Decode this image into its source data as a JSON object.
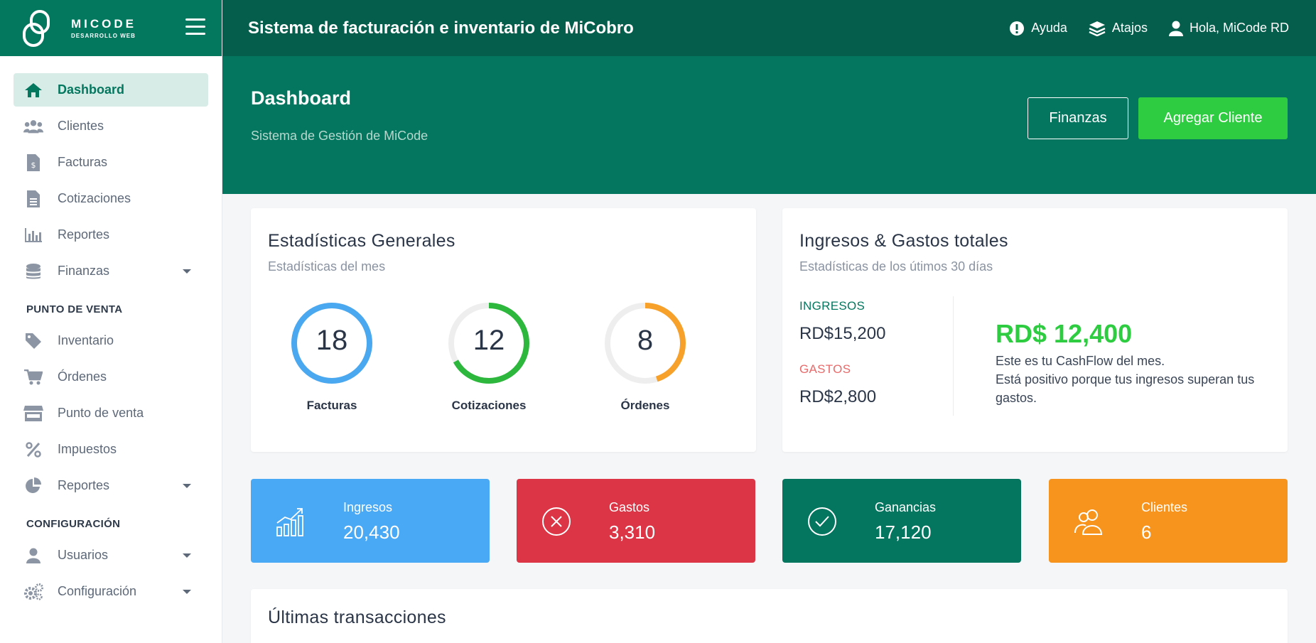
{
  "brand": {
    "name": "MICODE",
    "tagline": "DESARROLLO WEB"
  },
  "topbar": {
    "title": "Sistema de facturación e inventario de MiCobro",
    "help": "Ayuda",
    "shortcuts": "Atajos",
    "user": "Hola, MiCode RD"
  },
  "sidebar": {
    "items": [
      {
        "label": "Dashboard",
        "icon": "home-icon"
      },
      {
        "label": "Clientes",
        "icon": "users-icon"
      },
      {
        "label": "Facturas",
        "icon": "invoice-icon"
      },
      {
        "label": "Cotizaciones",
        "icon": "file-icon"
      },
      {
        "label": "Reportes",
        "icon": "bar-chart-icon"
      },
      {
        "label": "Finanzas",
        "icon": "coins-icon"
      }
    ],
    "section_pos": "PUNTO DE VENTA",
    "pos_items": [
      {
        "label": "Inventario",
        "icon": "tag-icon"
      },
      {
        "label": "Órdenes",
        "icon": "cart-icon"
      },
      {
        "label": "Punto de venta",
        "icon": "store-icon"
      },
      {
        "label": "Impuestos",
        "icon": "percent-icon"
      },
      {
        "label": "Reportes",
        "icon": "pie-chart-icon"
      }
    ],
    "section_config": "CONFIGURACIÓN",
    "config_items": [
      {
        "label": "Usuarios",
        "icon": "user-icon"
      },
      {
        "label": "Configuración",
        "icon": "gears-icon"
      }
    ]
  },
  "banner": {
    "title": "Dashboard",
    "subtitle": "Sistema de Gestión de MiCode",
    "btn_finance": "Finanzas",
    "btn_add_client": "Agregar Cliente"
  },
  "general_stats": {
    "title": "Estadísticas Generales",
    "subtitle": "Estadísticas del mes",
    "items": [
      {
        "value": "18",
        "label": "Facturas",
        "fraction": 1.0,
        "color": "#4aa8f0"
      },
      {
        "value": "12",
        "label": "Cotizaciones",
        "fraction": 0.67,
        "color": "#2db83d"
      },
      {
        "value": "8",
        "label": "Órdenes",
        "fraction": 0.45,
        "color": "#f7a12a"
      }
    ]
  },
  "income_expenses": {
    "title": "Ingresos & Gastos totales",
    "subtitle": "Estadísticas de los útimos 30 días",
    "income_label": "INGRESOS",
    "income_value": "RD$15,200",
    "expense_label": "GASTOS",
    "expense_value": "RD$2,800",
    "cashflow_value": "RD$ 12,400",
    "cashflow_text1": "Este es tu CashFlow del mes.",
    "cashflow_text2": "Está positivo porque tus ingresos superan tus gastos."
  },
  "tiles": [
    {
      "label": "Ingresos",
      "value": "20,430",
      "color": "#4aa9f5",
      "icon": "growth-chart-icon"
    },
    {
      "label": "Gastos",
      "value": "3,310",
      "color": "#dc3545",
      "icon": "x-circle-icon"
    },
    {
      "label": "Ganancias",
      "value": "17,120",
      "color": "#04755e",
      "icon": "check-circle-icon"
    },
    {
      "label": "Clientes",
      "value": "6",
      "color": "#f7941d",
      "icon": "people-icon"
    }
  ],
  "transactions": {
    "title": "Últimas transacciones"
  }
}
